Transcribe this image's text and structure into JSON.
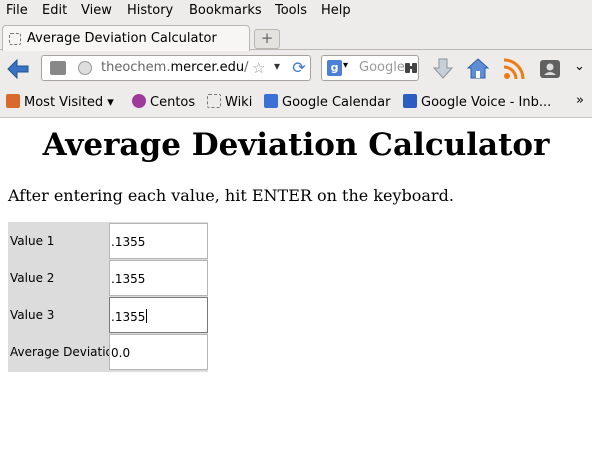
{
  "menu": [
    {
      "name": "menu-file",
      "label": "File"
    },
    {
      "name": "menu-edit",
      "label": "Edit"
    },
    {
      "name": "menu-view",
      "label": "View"
    },
    {
      "name": "menu-history",
      "label": "History"
    },
    {
      "name": "menu-bookmarks",
      "label": "Bookmarks"
    },
    {
      "name": "menu-tools",
      "label": "Tools"
    },
    {
      "name": "menu-help",
      "label": "Help"
    }
  ],
  "tab": {
    "title": "Average Deviation Calculator",
    "new_tab": "+"
  },
  "navbar": {
    "url_prefix": "theochem.",
    "url_host": "mercer.edu",
    "url_suffix": "/",
    "search_placeholder": "Google"
  },
  "bookmarks": [
    {
      "name": "bookmark-most-visited",
      "label": "Most Visited",
      "icon": "folder-icon",
      "color": "#d86a2b"
    },
    {
      "name": "bookmark-centos",
      "label": "Centos",
      "icon": "centos-icon",
      "color": "#9c3b9b"
    },
    {
      "name": "bookmark-wiki",
      "label": "Wiki",
      "icon": "page-icon",
      "color": "#ffffff"
    },
    {
      "name": "bookmark-google-calendar",
      "label": "Google Calendar",
      "icon": "calendar-icon",
      "color": "#3b70d4"
    },
    {
      "name": "bookmark-google-voice",
      "label": "Google Voice - Inb...",
      "icon": "phone-icon",
      "color": "#2a5dbf"
    }
  ],
  "page": {
    "title": "Average Deviation Calculator",
    "instructions": "After entering each value, hit ENTER on the keyboard.",
    "rows": [
      {
        "label": "Value 1",
        "value": ".1355"
      },
      {
        "label": "Value 2",
        "value": ".1355"
      },
      {
        "label": "Value 3",
        "value": ".1355"
      },
      {
        "label": "Average Deviation",
        "value": "0.0"
      }
    ]
  }
}
